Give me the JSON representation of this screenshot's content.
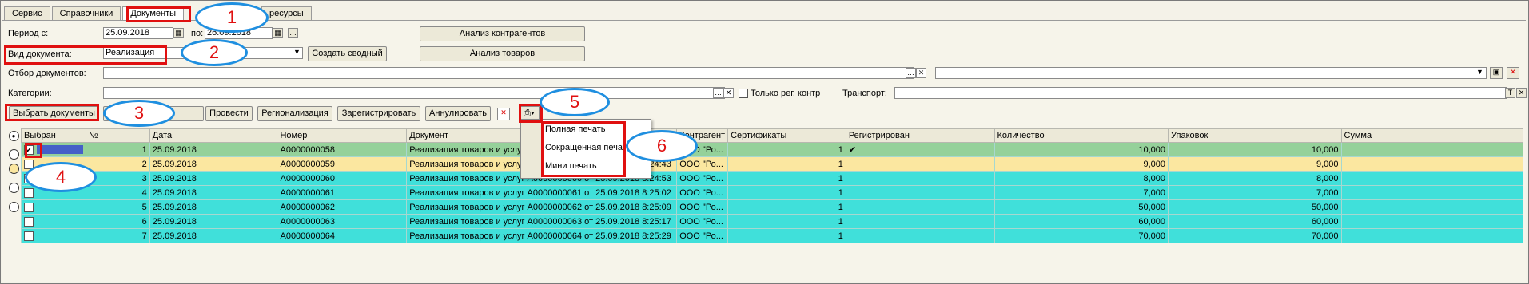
{
  "tabs": [
    "Сервис",
    "Справочники",
    "Документы",
    "ресурсы"
  ],
  "filters": {
    "period_from_label": "Период с:",
    "period_from_value": "25.09.2018",
    "period_to_label": "по:",
    "period_to_value": "26.09.2018",
    "doc_type_label": "Вид документа:",
    "doc_type_value": "Реализация",
    "doc_selection_label": "Отбор документов:",
    "categories_label": "Категории:",
    "only_reg_label": "Только рег. контр",
    "transport_label": "Транспорт:"
  },
  "buttons": {
    "create_summary": "Создать сводный",
    "counterparty_analysis": "Анализ контрагентов",
    "goods_analysis": "Анализ товаров",
    "select_documents": "Выбрать документы",
    "create": "Создать",
    "post": "Провести",
    "regionalization": "Регионализация",
    "register": "Зарегистрировать",
    "annul": "Аннулировать"
  },
  "popup_menu": [
    "Полная печать",
    "Сокращенная печать",
    "Мини печать"
  ],
  "annotations": [
    "1",
    "2",
    "3",
    "4",
    "5",
    "6"
  ],
  "table": {
    "headers": [
      "Выбран",
      "№",
      "Дата",
      "Номер",
      "Документ",
      "Контрагент",
      "Сертификаты",
      "Регистрирован",
      "Количество",
      "Упаковок",
      "Сумма"
    ],
    "rows": [
      {
        "n": "1",
        "date": "25.09.2018",
        "num": "A0000000058",
        "doc": "Реализация товаров и услуг A0000000058 от 25.09.2018 8:24:40",
        "ctr": "ООО \"Ро...",
        "cert": "1",
        "reg": "✔",
        "qty": "10,000",
        "pack": "10,000",
        "sum": ""
      },
      {
        "n": "2",
        "date": "25.09.2018",
        "num": "A0000000059",
        "doc": "Реализация товаров и услуг A0000000059 от 25.09.2018 8:24:43",
        "ctr": "ООО \"Ро...",
        "cert": "1",
        "reg": "",
        "qty": "9,000",
        "pack": "9,000",
        "sum": ""
      },
      {
        "n": "3",
        "date": "25.09.2018",
        "num": "A0000000060",
        "doc": "Реализация товаров и услуг A0000000060 от 25.09.2018 8:24:53",
        "ctr": "ООО \"Ро...",
        "cert": "1",
        "reg": "",
        "qty": "8,000",
        "pack": "8,000",
        "sum": ""
      },
      {
        "n": "4",
        "date": "25.09.2018",
        "num": "A0000000061",
        "doc": "Реализация товаров и услуг A0000000061 от 25.09.2018 8:25:02",
        "ctr": "ООО \"Ро...",
        "cert": "1",
        "reg": "",
        "qty": "7,000",
        "pack": "7,000",
        "sum": ""
      },
      {
        "n": "5",
        "date": "25.09.2018",
        "num": "A0000000062",
        "doc": "Реализация товаров и услуг A0000000062 от 25.09.2018 8:25:09",
        "ctr": "ООО \"Ро...",
        "cert": "1",
        "reg": "",
        "qty": "50,000",
        "pack": "50,000",
        "sum": ""
      },
      {
        "n": "6",
        "date": "25.09.2018",
        "num": "A0000000063",
        "doc": "Реализация товаров и услуг A0000000063 от 25.09.2018 8:25:17",
        "ctr": "ООО \"Ро...",
        "cert": "1",
        "reg": "",
        "qty": "60,000",
        "pack": "60,000",
        "sum": ""
      },
      {
        "n": "7",
        "date": "25.09.2018",
        "num": "A0000000064",
        "doc": "Реализация товаров и услуг A0000000064 от 25.09.2018 8:25:29",
        "ctr": "ООО \"Ро...",
        "cert": "1",
        "reg": "",
        "qty": "70,000",
        "pack": "70,000",
        "sum": ""
      }
    ]
  },
  "colors": {
    "row_selected": "#95d19a",
    "row_highlight": "#fbe7a0",
    "row_normal": "#40e0da",
    "annotation_red": "#e01010",
    "annotation_blue": "#1f8fe0"
  }
}
